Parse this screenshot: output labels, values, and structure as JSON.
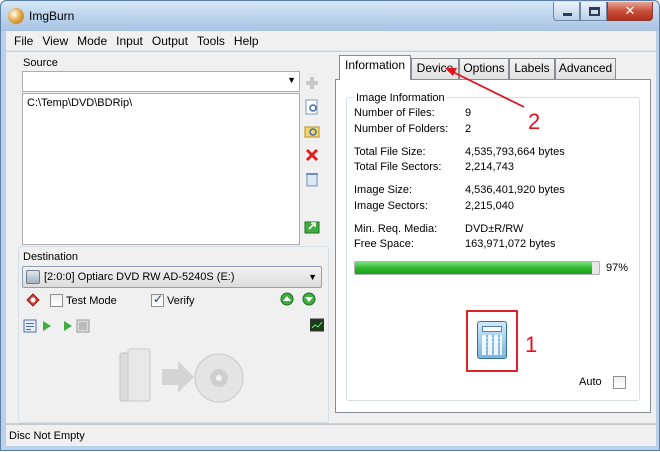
{
  "window": {
    "title": "ImgBurn"
  },
  "menu": [
    "File",
    "View",
    "Mode",
    "Input",
    "Output",
    "Tools",
    "Help"
  ],
  "source": {
    "label": "Source",
    "combo_value": "",
    "list_items": [
      "C:\\Temp\\DVD\\BDRip\\"
    ]
  },
  "destination": {
    "label": "Destination",
    "drive": "[2:0:0] Optiarc DVD RW AD-5240S (E:)",
    "test_mode": {
      "label": "Test Mode",
      "checked": false
    },
    "verify": {
      "label": "Verify",
      "checked": true
    }
  },
  "tabs": [
    "Information",
    "Device",
    "Options",
    "Labels",
    "Advanced"
  ],
  "active_tab": "Information",
  "image_info": {
    "header": "Image Information",
    "rows": [
      {
        "label": "Number of Files:",
        "value": "9"
      },
      {
        "label": "Number of Folders:",
        "value": "2"
      },
      {
        "label": "Total File Size:",
        "value": "4,535,793,664 bytes"
      },
      {
        "label": "Total File Sectors:",
        "value": "2,214,743"
      },
      {
        "label": "Image Size:",
        "value": "4,536,401,920 bytes"
      },
      {
        "label": "Image Sectors:",
        "value": "2,215,040"
      },
      {
        "label": "Min. Req. Media:",
        "value": "DVD±R/RW"
      },
      {
        "label": "Free Space:",
        "value": "163,971,072 bytes"
      }
    ],
    "progress_fraction": 0.97,
    "progress_text": "97%",
    "auto": {
      "label": "Auto",
      "checked": false
    }
  },
  "annotations": [
    "1",
    "2"
  ],
  "status": "Disc Not Empty",
  "colors": {
    "annotation": "#e0141e",
    "progress": "#2fb82f"
  }
}
